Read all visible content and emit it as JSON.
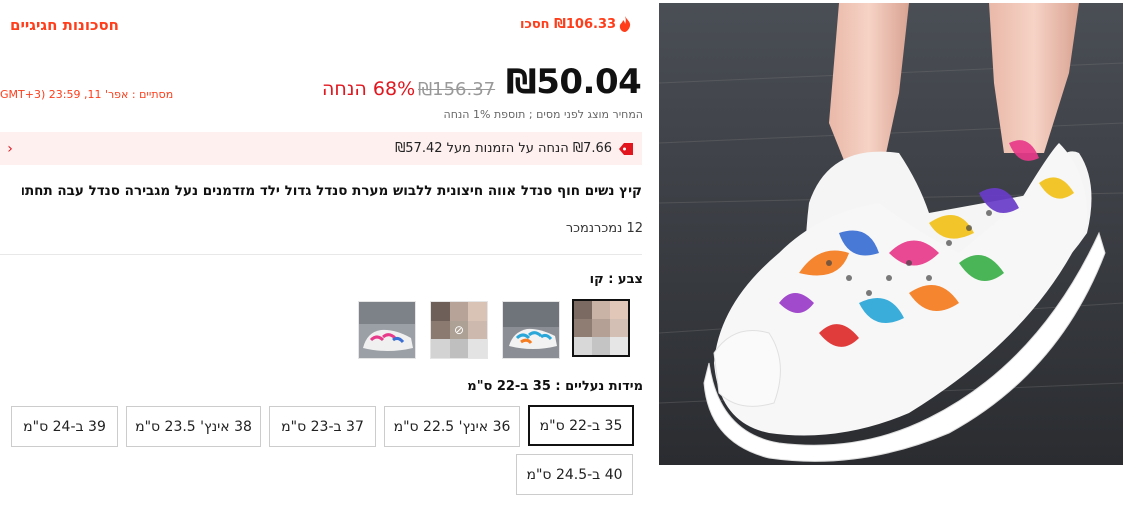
{
  "header": {
    "festival_label": "חסכונות חגיגיים",
    "save_text": "₪106.33 חסכו"
  },
  "pricing": {
    "price": "₪50.04",
    "original_price": "₪156.37",
    "discount": "68% הנחה",
    "price_note": "המחיר מוצג לפני מסים ; תוספת 1% הנחה",
    "countdown": "מסתיים : אפר' 11, 23:59 (GMT+3"
  },
  "coupon": {
    "text": "₪7.66 הנחה על הזמנות מעל ₪57.42",
    "chevron": "›"
  },
  "product": {
    "title": "קיץ נשים חוף סנדל אווה חיצונית ללבוש מערת סנדל גדול ילד מזדמנים נעל מגבירה סנדל עבה תחתון חור",
    "recommend": "12 נמכרנמכר"
  },
  "color": {
    "label": "צבע : קו",
    "swatches": [
      "swatch-1",
      "swatch-2",
      "swatch-3",
      "swatch-4"
    ],
    "selected_index": 0
  },
  "sizes": {
    "label": "מידות נעליים : 35 ב-22 ס\"מ",
    "options": [
      "35 ב-22 ס\"מ",
      "36 אינץ' 22.5 ס\"מ",
      "37 ב-23 ס\"מ",
      "38 אינץ' 23.5 ס\"מ",
      "39 ב-24 ס\"מ",
      "40 ב-24.5 ס\"מ"
    ],
    "selected_index": 0
  },
  "colors": {
    "accent_red": "#e1161e",
    "orange_red": "#ff3d1a",
    "coupon_bg": "#fff0f0"
  }
}
